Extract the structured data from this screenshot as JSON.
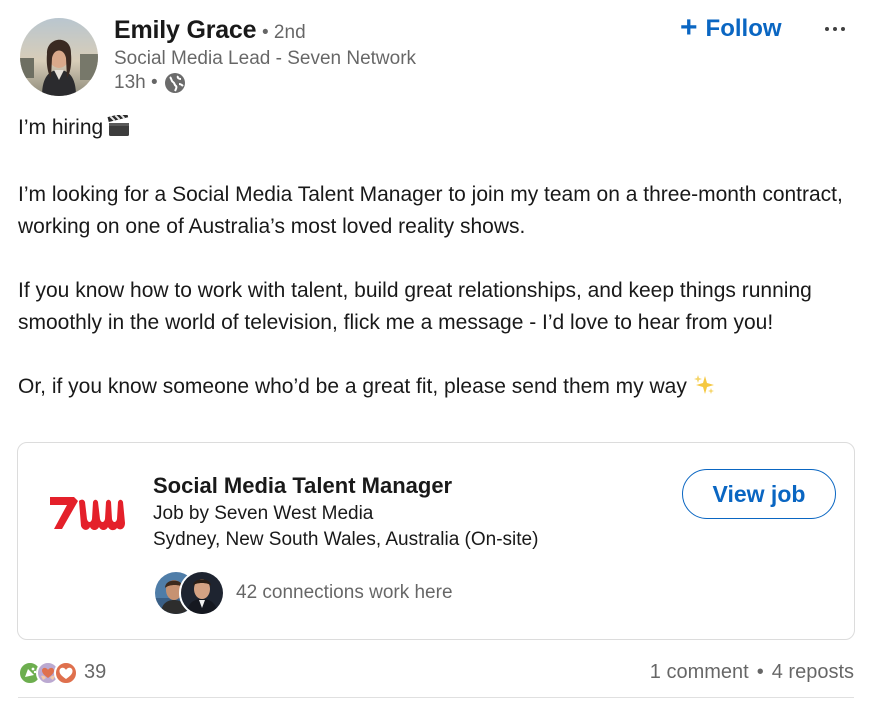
{
  "author": {
    "name": "Emily Grace",
    "degree": "• 2nd",
    "headline": "Social Media Lead - Seven Network",
    "time": "13h •"
  },
  "actions": {
    "follow_label": "Follow",
    "follow_icon": "+"
  },
  "post": {
    "line1": "I’m hiring",
    "para2": "I’m looking for a Social Media Talent Manager to join my team on a three-month contract, working on one of Australia’s most loved reality shows.",
    "para3": "If you know how to work with talent, build great relationships, and keep things running smoothly in the world of television, flick me a message - I’d love to hear from you!",
    "para4": "Or, if you know someone who’d be a great fit, please send them my way"
  },
  "job": {
    "title": "Social Media Talent Manager",
    "company": "Job by Seven West Media",
    "location": "Sydney, New South Wales, Australia (On-site)",
    "view_label": "View job",
    "connections": "42 connections work here"
  },
  "social": {
    "reactions": "39",
    "comments": "1 comment",
    "separator": "•",
    "reposts": "4 reposts"
  },
  "colors": {
    "accent": "#0a66c2",
    "brand_red": "#e4202a"
  }
}
